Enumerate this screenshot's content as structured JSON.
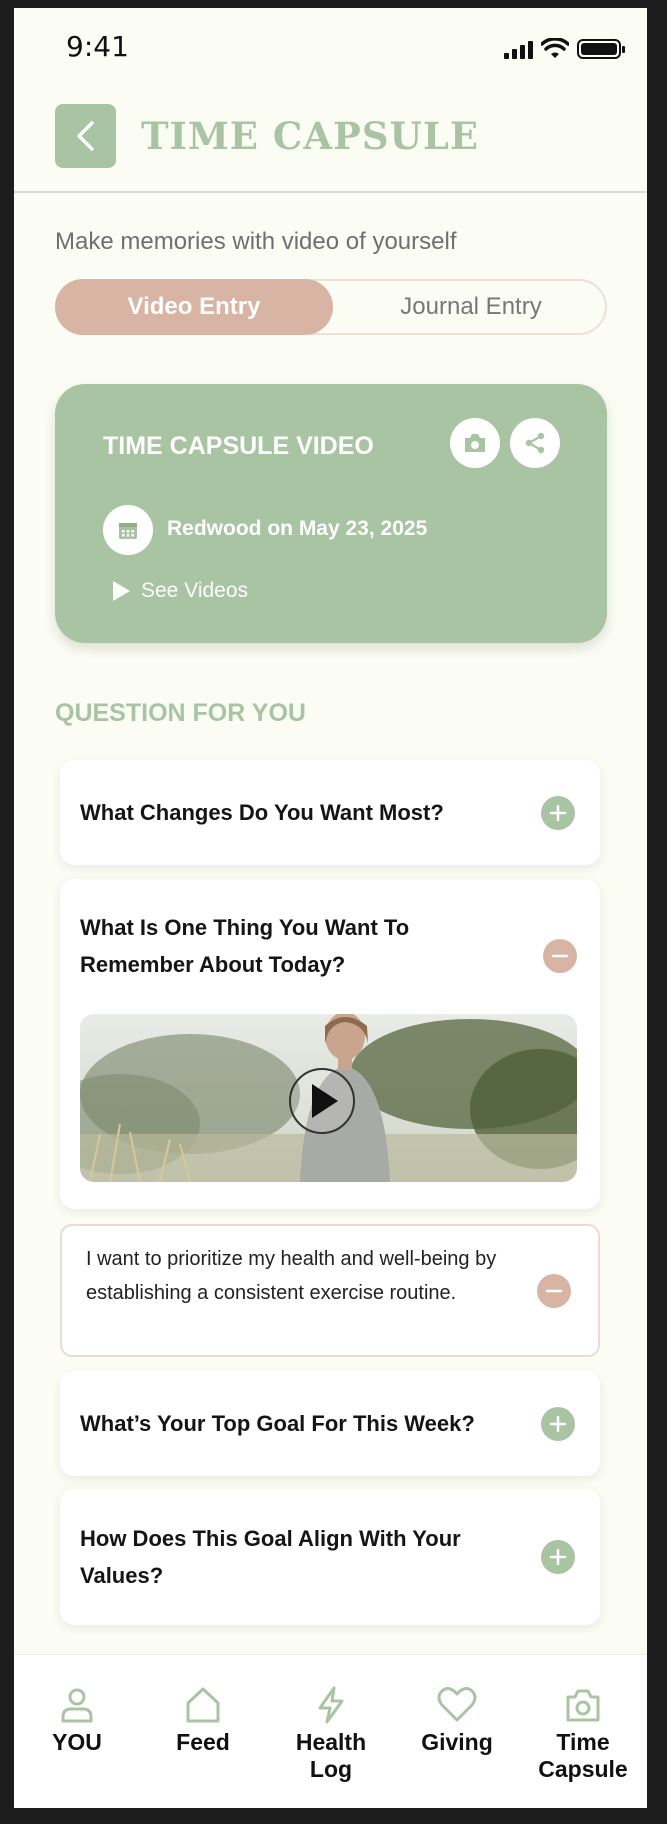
{
  "status_bar": {
    "time": "9:41"
  },
  "header": {
    "title": "TIME CAPSULE"
  },
  "subtitle": "Make memories with video of yourself",
  "toggle": {
    "active": "Video Entry",
    "inactive": "Journal Entry"
  },
  "video_card": {
    "title": "TIME CAPSULE VIDEO",
    "date_text": "Redwood on May 23, 2025",
    "see_videos": "See Videos"
  },
  "section_title": "QUESTION FOR YOU",
  "questions": [
    {
      "text": "What Changes Do You Want Most?",
      "state": "collapsed"
    },
    {
      "text": "What Is One Thing You Want To Remember About Today?",
      "state": "expanded"
    },
    {
      "text": "What’s Your Top Goal For This Week?",
      "state": "collapsed"
    },
    {
      "text": "How Does This Goal Align With Your Values?",
      "state": "collapsed"
    }
  ],
  "answer": {
    "text": "I want to prioritize my health and well-being by establishing a consistent exercise routine."
  },
  "colors": {
    "accent_green": "#a9c4a2",
    "accent_rose": "#d8b4a4",
    "background": "#fbfdf4"
  },
  "bottom_nav": [
    {
      "label": "YOU",
      "icon": "user-icon"
    },
    {
      "label": "Feed",
      "icon": "home-icon"
    },
    {
      "label": "Health Log",
      "icon": "bolt-icon"
    },
    {
      "label": "Giving",
      "icon": "heart-icon"
    },
    {
      "label": "Time Capsule",
      "icon": "camera-icon"
    }
  ]
}
